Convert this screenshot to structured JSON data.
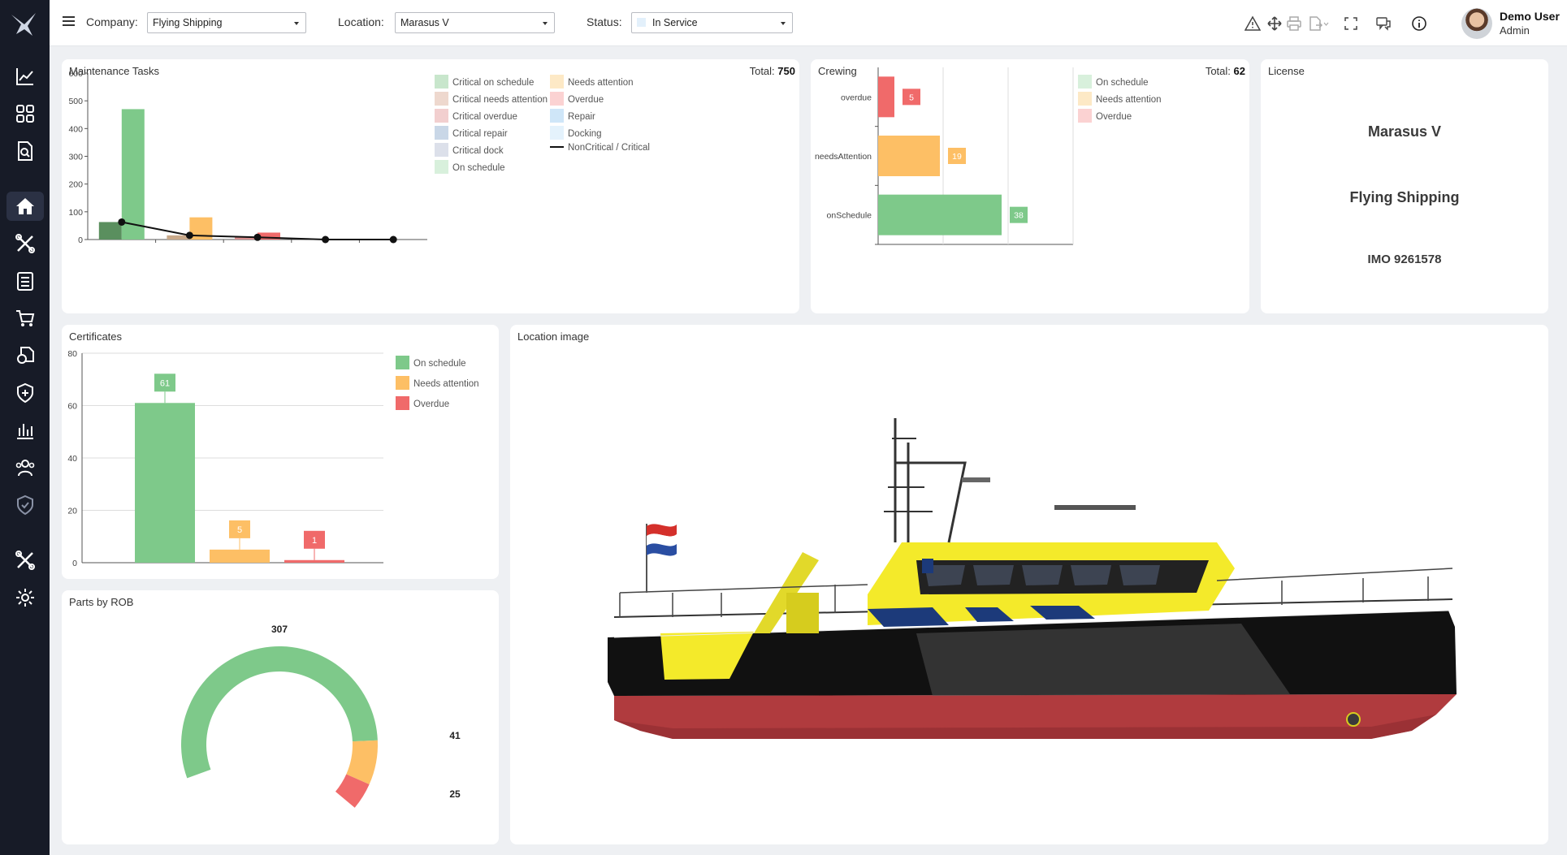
{
  "topbar": {
    "company_label": "Company:",
    "company_value": "Flying Shipping",
    "location_label": "Location:",
    "location_value": "Marasus V",
    "status_label": "Status:",
    "status_value": "In Service",
    "user_name": "Demo User",
    "user_role": "Admin"
  },
  "sidebar": {
    "items": [
      "dashboard-chart",
      "grid",
      "document-search",
      "home",
      "tools",
      "checklist",
      "cart",
      "documents",
      "shield-plus",
      "bar-chart",
      "users",
      "shield-check",
      "tools-2",
      "settings"
    ],
    "active": "home"
  },
  "colors": {
    "sidebar": "#171b27",
    "green": "#7ec98a",
    "orange": "#fdbf65",
    "red": "#f06a6a",
    "dark_green": "#5a8f5e"
  },
  "maintenance": {
    "title": "Maintenance Tasks",
    "total_label": "Total:",
    "total_value": "750",
    "legend_left": [
      "Critical on schedule",
      "Critical needs attention",
      "Critical overdue",
      "Critical repair",
      "Critical dock",
      "On schedule"
    ],
    "legend_right": [
      "Needs attention",
      "Overdue",
      "Repair",
      "Docking",
      "NonCritical / Critical"
    ]
  },
  "crewing": {
    "title": "Crewing",
    "total_label": "Total:",
    "total_value": "62",
    "legend": [
      "On schedule",
      "Needs attention",
      "Overdue"
    ]
  },
  "license": {
    "title": "License",
    "vessel": "Marasus V",
    "company": "Flying Shipping",
    "imo": "IMO 9261578"
  },
  "certificates": {
    "title": "Certificates",
    "legend": [
      "On schedule",
      "Needs attention",
      "Overdue"
    ]
  },
  "parts": {
    "title": "Parts by ROB"
  },
  "location_image": {
    "title": "Location image"
  },
  "chart_data": [
    {
      "type": "bar",
      "title": "Maintenance Tasks",
      "ylim": [
        0,
        600
      ],
      "yticks": [
        "0",
        "100",
        "200",
        "300",
        "400",
        "500",
        "600"
      ],
      "groups": [
        {
          "critical": 63,
          "noncritical": 470,
          "critical_color": "#5a8f5e",
          "noncritical_color": "#7ec98a"
        },
        {
          "critical": 15,
          "noncritical": 80,
          "critical_color": "#c9a98a",
          "noncritical_color": "#fdbf65"
        },
        {
          "critical": 8,
          "noncritical": 25,
          "critical_color": "#d98f8f",
          "noncritical_color": "#f06a6a"
        },
        {
          "critical": 0,
          "noncritical": 0,
          "critical_color": "#9fb7d3",
          "noncritical_color": "#a8d4f5"
        },
        {
          "critical": 0,
          "noncritical": 0,
          "critical_color": "#b9bed4",
          "noncritical_color": "#d6ecfa"
        }
      ],
      "line": {
        "name": "NonCritical / Critical",
        "values": [
          63,
          15,
          8,
          0,
          0
        ]
      }
    },
    {
      "type": "bar",
      "title": "Crewing",
      "orientation": "horizontal",
      "categories": [
        "overdue",
        "needsAttention",
        "onSchedule"
      ],
      "values": [
        5,
        19,
        38
      ],
      "colors": [
        "#f06a6a",
        "#fdbf65",
        "#7ec98a"
      ],
      "xlim": [
        0,
        60
      ]
    },
    {
      "type": "bar",
      "title": "Certificates",
      "categories": [
        "On schedule",
        "Needs attention",
        "Overdue"
      ],
      "values": [
        61,
        5,
        1
      ],
      "colors": [
        "#7ec98a",
        "#fdbf65",
        "#f06a6a"
      ],
      "ylim": [
        0,
        80
      ],
      "yticks": [
        "0",
        "20",
        "40",
        "60",
        "80"
      ]
    },
    {
      "type": "pie",
      "title": "Parts by ROB",
      "categories": [
        "On schedule",
        "Needs attention",
        "Overdue"
      ],
      "values": [
        307,
        41,
        25
      ],
      "labels": [
        "307",
        "41",
        "25"
      ],
      "colors": [
        "#7ec98a",
        "#fdbf65",
        "#f06a6a"
      ]
    }
  ]
}
